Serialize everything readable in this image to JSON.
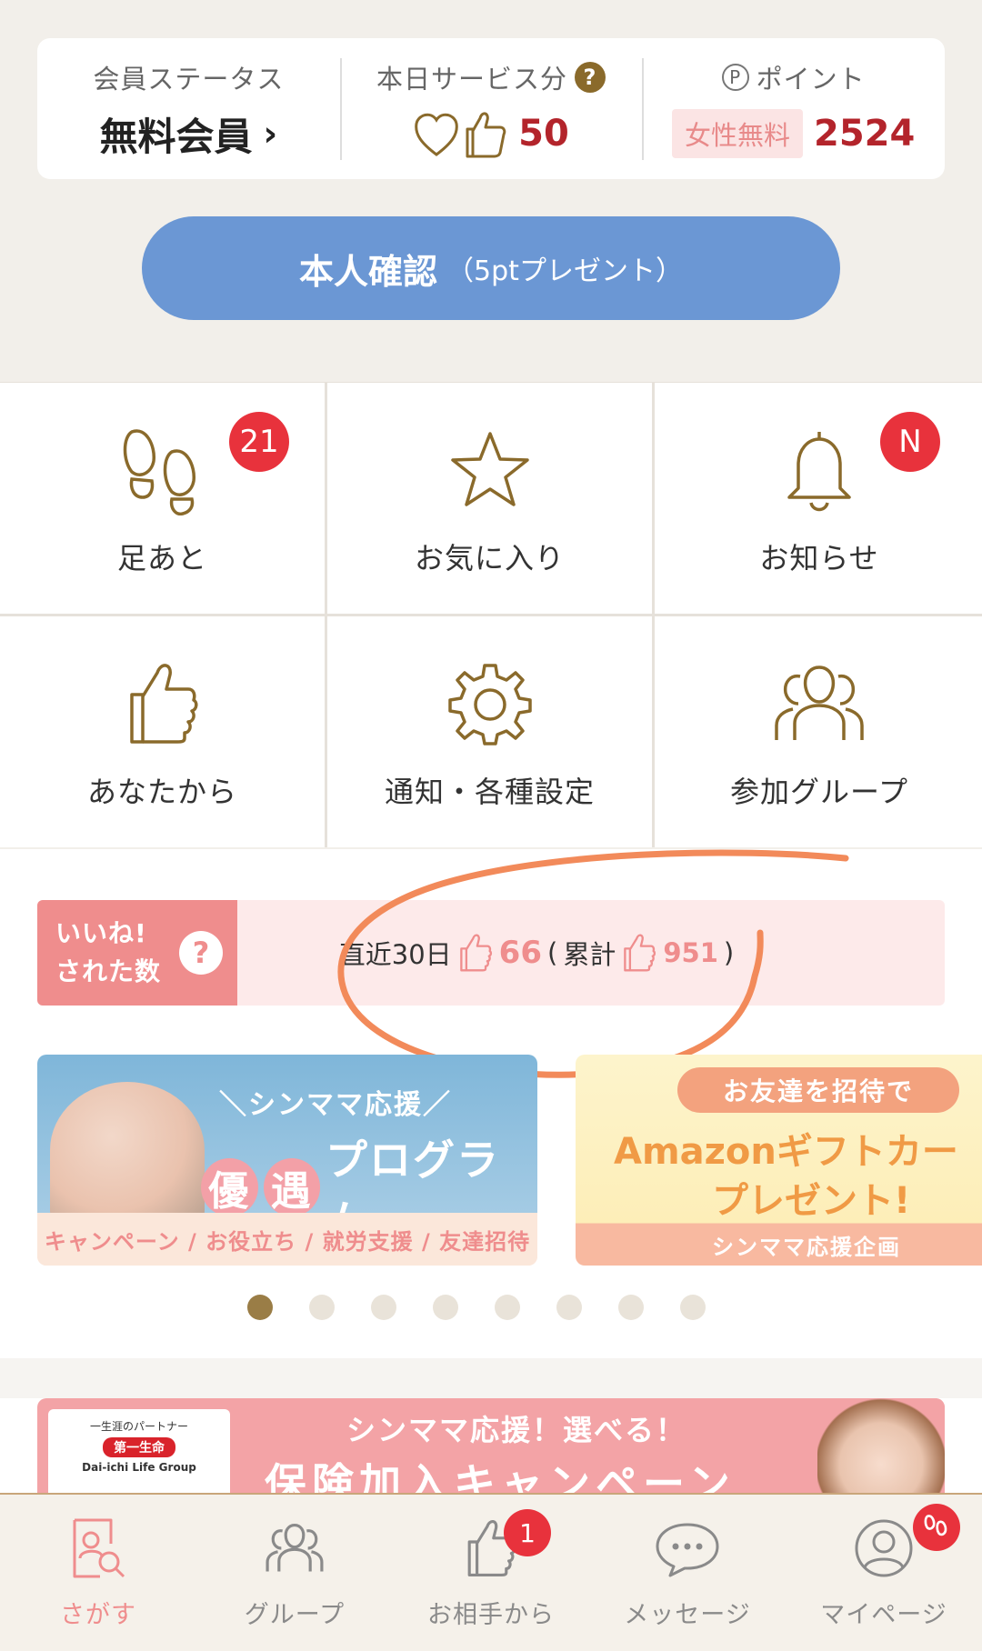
{
  "status": {
    "member_label": "会員ステータス",
    "member_value": "無料会員",
    "service_label": "本日サービス分",
    "service_help": "?",
    "service_value": "50",
    "point_label": "ポイント",
    "point_prefix": "P",
    "point_tag": "女性無料",
    "point_value": "2524"
  },
  "verify": {
    "main": "本人確認",
    "sub": "（5ptプレゼント）"
  },
  "menu": [
    {
      "label": "足あと",
      "badge": "21"
    },
    {
      "label": "お気に入り"
    },
    {
      "label": "お知らせ",
      "badge": "N"
    },
    {
      "label": "あなたから"
    },
    {
      "label": "通知・各種設定"
    },
    {
      "label": "参加グループ"
    }
  ],
  "likes": {
    "label_line1": "いいね!",
    "label_line2": "された数",
    "help": "?",
    "recent_label": "直近30日",
    "recent_value": "66",
    "open_paren": "(",
    "total_label": "累計",
    "total_value": "951",
    "close_paren": ")"
  },
  "banners": {
    "b1_head": "＼シンママ応援／",
    "b1_yu1": "優",
    "b1_yu2": "遇",
    "b1_title": "プログラム",
    "b1_foot": "キャンペーン / お役立ち / 就労支援 / 友達招待",
    "b2_pill": "お友達を招待で",
    "b2_title": "Amazonギフトカー",
    "b2_title2": "プレゼント!",
    "b2_foot": "シンママ応援企画",
    "dots_total": 8,
    "dots_active": 0
  },
  "insurance": {
    "logo_small": "一生涯のパートナー",
    "logo_red": "第一生命",
    "logo_en": "Dai-ichi Life Group",
    "head": "シンママ応援！選べる！",
    "title": "保険加入キャンペーン"
  },
  "tabs": [
    {
      "label": "さがす",
      "icon": "search-profile-icon",
      "active": true
    },
    {
      "label": "グループ",
      "icon": "group-icon"
    },
    {
      "label": "お相手から",
      "icon": "thumbs-up-icon",
      "badge": "1"
    },
    {
      "label": "メッセージ",
      "icon": "message-icon"
    },
    {
      "label": "マイページ",
      "icon": "user-icon"
    }
  ],
  "colors": {
    "accent_gold": "#8a6a2b",
    "badge_red": "#e8323c",
    "verify_blue": "#6b97d4",
    "like_pink": "#ef8d8d",
    "annotation_orange": "#f28a5a"
  }
}
